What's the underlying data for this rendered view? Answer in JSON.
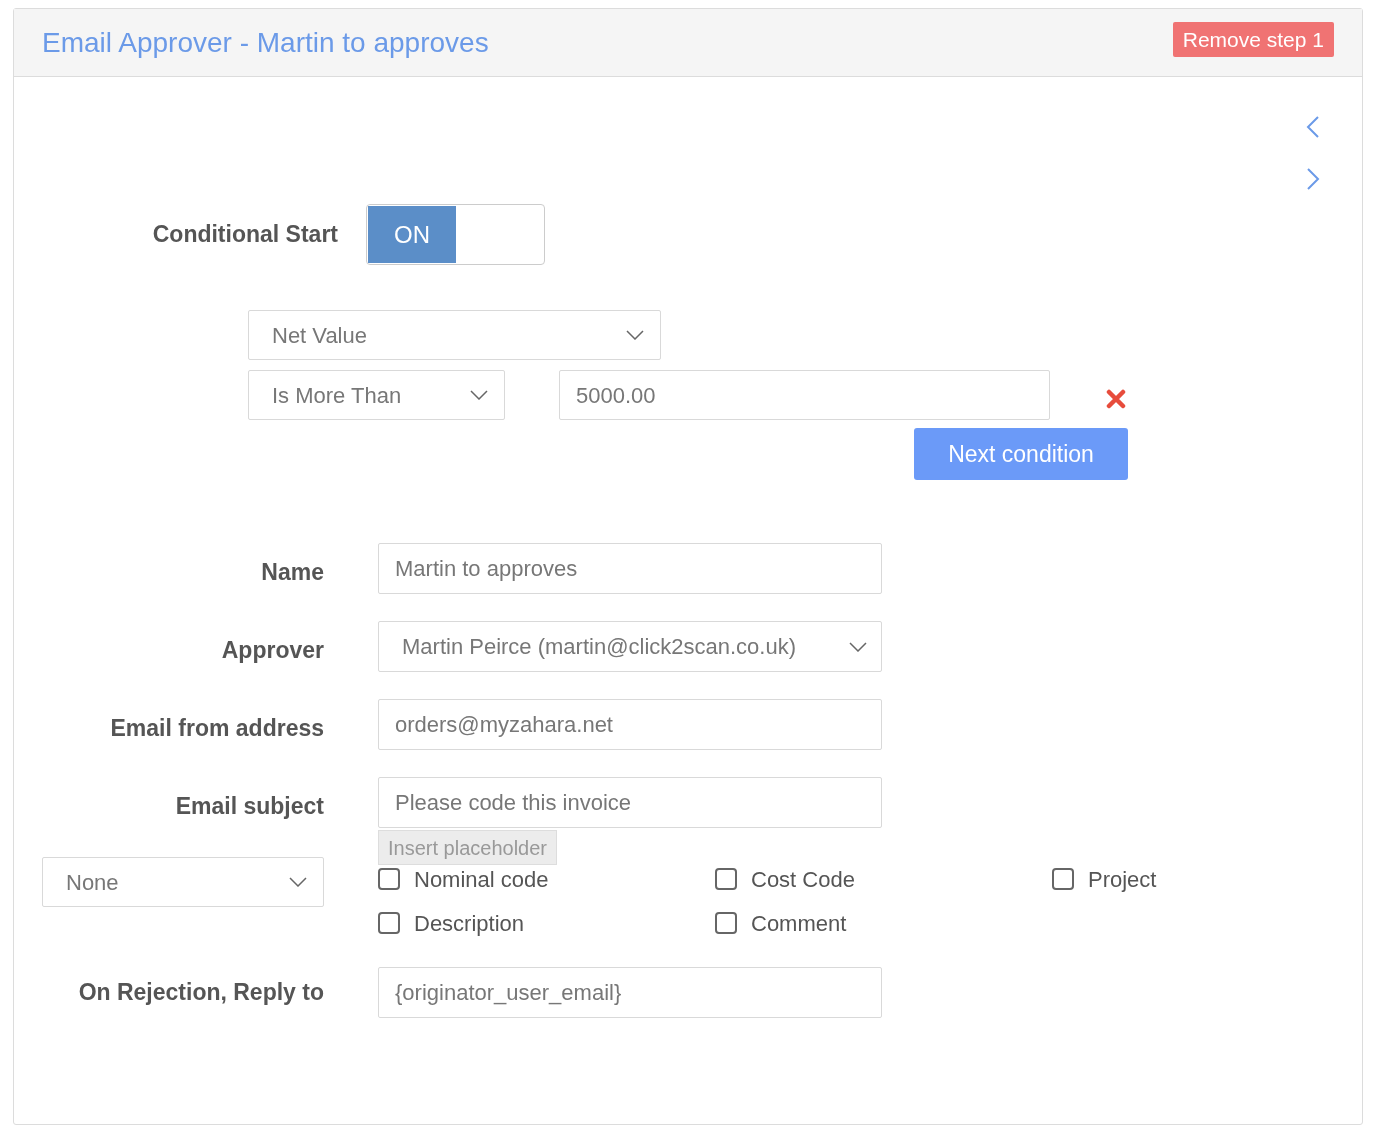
{
  "panel": {
    "title": "Email Approver - Martin to approves",
    "remove_button": "Remove step 1"
  },
  "conditional_start": {
    "label": "Conditional Start",
    "toggle": {
      "label": "ON",
      "on": true
    }
  },
  "condition": {
    "field": "Net Value",
    "operator": "Is More Than",
    "value": "5000.00",
    "next_button": "Next condition"
  },
  "form": [
    {
      "label": "Name",
      "kind": "input",
      "value": "Martin to approves"
    },
    {
      "label": "Approver",
      "kind": "select",
      "value": "Martin Peirce (martin@click2scan.co.uk)"
    },
    {
      "label": "Email from address",
      "kind": "input",
      "value": "orders@myzahara.net"
    },
    {
      "label": "Email subject",
      "kind": "input",
      "value": "Please code this invoice",
      "extra_button": "Insert placeholder"
    }
  ],
  "coding": {
    "select": "None",
    "checkboxes": [
      {
        "label": "Nominal code",
        "checked": false
      },
      {
        "label": "Cost Code",
        "checked": false
      },
      {
        "label": "Project",
        "checked": false
      },
      {
        "label": "Description",
        "checked": false
      },
      {
        "label": "Comment",
        "checked": false
      }
    ]
  },
  "rejection": {
    "label": "On Rejection, Reply to",
    "value": "{originator_user_email}"
  }
}
